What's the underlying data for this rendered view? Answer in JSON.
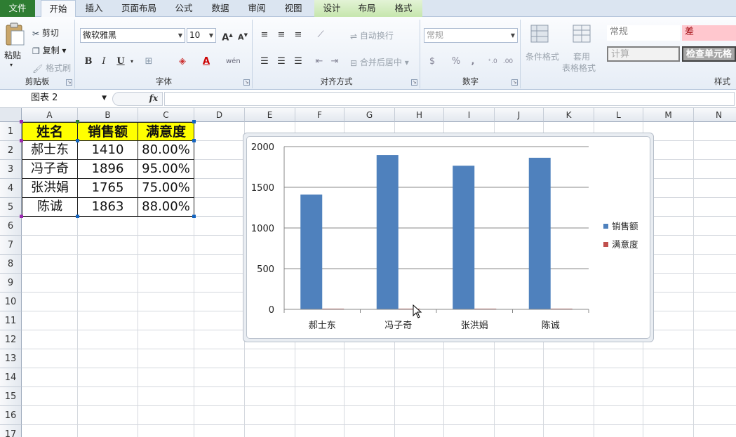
{
  "ribbon_tabs": [
    {
      "label": "文件"
    },
    {
      "label": "开始"
    },
    {
      "label": "插入"
    },
    {
      "label": "页面布局"
    },
    {
      "label": "公式"
    },
    {
      "label": "数据"
    },
    {
      "label": "审阅"
    },
    {
      "label": "视图"
    },
    {
      "label": "设计"
    },
    {
      "label": "布局"
    },
    {
      "label": "格式"
    }
  ],
  "clipboard": {
    "paste": "粘贴",
    "cut": "剪切",
    "copy": "复制",
    "format_painter": "格式刷",
    "group": "剪贴板"
  },
  "font": {
    "name": "微软雅黑",
    "size": "10",
    "bold": "B",
    "italic": "I",
    "underline": "U",
    "group": "字体"
  },
  "alignment": {
    "wrap": "自动换行",
    "merge": "合并后居中",
    "group": "对齐方式"
  },
  "number": {
    "format": "常规",
    "percent": "%",
    "comma": ",",
    "inc_decimal": "←.0\n.00",
    "group": "数字"
  },
  "styles": {
    "conditional": "条件格式",
    "table_format_1": "套用",
    "table_format_2": "表格格式",
    "normal": "常规",
    "bad": "差",
    "calc": "计算",
    "check": "检查单元格",
    "group": "样式"
  },
  "formula_bar": {
    "name_box": "图表 2",
    "fx": "fx"
  },
  "columns": [
    "A",
    "B",
    "C",
    "D",
    "E",
    "F",
    "G",
    "H",
    "I",
    "J",
    "K",
    "L",
    "M",
    "N"
  ],
  "rows": [
    "1",
    "2",
    "3",
    "4",
    "5",
    "6",
    "7",
    "8",
    "9",
    "10",
    "11",
    "12",
    "13",
    "14",
    "15",
    "16",
    "17"
  ],
  "table": {
    "headers": [
      "姓名",
      "销售额",
      "满意度"
    ],
    "rows": [
      [
        "郝士东",
        "1410",
        "80.00%"
      ],
      [
        "冯子奇",
        "1896",
        "95.00%"
      ],
      [
        "张洪娟",
        "1765",
        "75.00%"
      ],
      [
        "陈诚",
        "1863",
        "88.00%"
      ]
    ]
  },
  "colors": {
    "series_sales": "#4f81bd",
    "series_satisfaction": "#c0504d",
    "header_fill": "#ffff00"
  },
  "chart_data": {
    "type": "bar",
    "categories": [
      "郝士东",
      "冯子奇",
      "张洪娟",
      "陈诚"
    ],
    "series": [
      {
        "name": "销售额",
        "values": [
          1410,
          1896,
          1765,
          1863
        ]
      },
      {
        "name": "满意度",
        "values": [
          0.8,
          0.95,
          0.75,
          0.88
        ]
      }
    ],
    "yticks": [
      "0",
      "500",
      "1000",
      "1500",
      "2000"
    ],
    "ylim": [
      0,
      2000
    ],
    "grid": true,
    "legend": "right"
  }
}
